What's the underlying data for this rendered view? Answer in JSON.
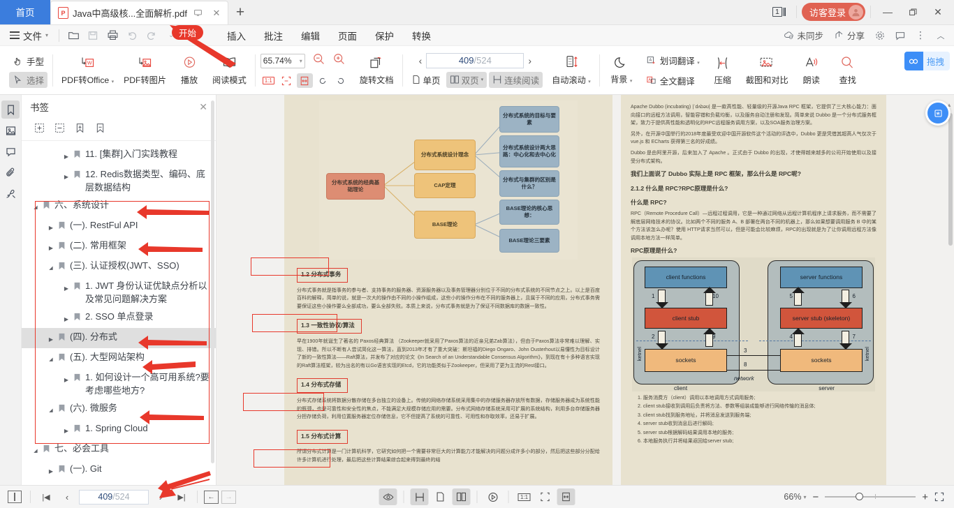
{
  "tabs": {
    "home_label": "首页",
    "doc_title": "Java中高级核...全面解析.pdf",
    "newtab_label": "+",
    "pdf_badge": "P"
  },
  "titlebar": {
    "page_count_badge": "1",
    "login_label": "访客登录",
    "minimize": "—",
    "restore": "❐",
    "close": "✕"
  },
  "menubar": {
    "file_label": "文件",
    "items": [
      "开始",
      "插入",
      "批注",
      "编辑",
      "页面",
      "保护",
      "转换"
    ],
    "active_item": "开始",
    "sync_label": "未同步",
    "share_label": "分享"
  },
  "ribbon": {
    "hand_label": "手型",
    "select_label": "选择",
    "pdf_to_office": "PDF转Office",
    "pdf_to_image": "PDF转图片",
    "play": "播放",
    "read_mode": "阅读模式",
    "zoom_value": "65.74%",
    "rotate_doc": "旋转文档",
    "page_current": "409",
    "page_sep": "/",
    "page_total": "524",
    "single_page": "单页",
    "double_page": "双页",
    "continuous_read": "连续阅读",
    "auto_scroll": "自动滚动",
    "background": "背景",
    "word_translate": "划词翻译",
    "full_translate": "全文翻译",
    "compress": "压缩",
    "screenshot_compare": "截图和对比",
    "read_aloud": "朗读",
    "find": "查找",
    "drag_label": "拖拽",
    "onetoone": "1:1"
  },
  "sidebar": {
    "rails": [
      "bookmark-icon",
      "thumbnail-icon",
      "comment-icon",
      "attachment-icon",
      "signature-icon"
    ],
    "active_rail": 0,
    "panel_title": "书签",
    "close": "✕",
    "tools": [
      "expand-all-icon",
      "collapse-all-icon",
      "add-bookmark-icon",
      "remove-bookmark-icon"
    ],
    "items": [
      {
        "label": "11. [集群]入门实践教程",
        "indent": 2,
        "arrow": "▸",
        "highlight": false
      },
      {
        "label": "12. Redis数据类型、编码、底层数据结构",
        "indent": 2,
        "arrow": "▸",
        "highlight": false
      },
      {
        "label": "六、系统设计",
        "indent": 0,
        "arrow": "◢",
        "highlight": false
      },
      {
        "label": "(一). RestFul API",
        "indent": 1,
        "arrow": "▸",
        "highlight": false
      },
      {
        "label": "(二). 常用框架",
        "indent": 1,
        "arrow": "▸",
        "highlight": false
      },
      {
        "label": "(三). 认证授权(JWT、SSO)",
        "indent": 1,
        "arrow": "◢",
        "highlight": false
      },
      {
        "label": "1. JWT 身份认证优缺点分析以及常见问题解决方案",
        "indent": 2,
        "arrow": "▸",
        "highlight": false
      },
      {
        "label": "2. SSO 单点登录",
        "indent": 2,
        "arrow": "▸",
        "highlight": false
      },
      {
        "label": "(四). 分布式",
        "indent": 1,
        "arrow": "▸",
        "highlight": true
      },
      {
        "label": "(五). 大型网站架构",
        "indent": 1,
        "arrow": "◢",
        "highlight": false
      },
      {
        "label": "1. 如何设计一个高可用系统?要考虑哪些地方?",
        "indent": 2,
        "arrow": "▸",
        "highlight": false
      },
      {
        "label": "(六). 微服务",
        "indent": 1,
        "arrow": "◢",
        "highlight": false
      },
      {
        "label": "1. Spring Cloud",
        "indent": 2,
        "arrow": "▸",
        "highlight": false
      },
      {
        "label": "七、必会工具",
        "indent": 0,
        "arrow": "◢",
        "highlight": false
      },
      {
        "label": "(一). Git",
        "indent": 1,
        "arrow": "▸",
        "highlight": false
      }
    ]
  },
  "document": {
    "left_page": {
      "mindmap": {
        "root": "分布式系统的经典基础理论",
        "mid": [
          "分布式系统设计理念",
          "CAP定理",
          "BASE理论"
        ],
        "leaves_top": [
          "分布式系统的目标与要素",
          "分布式系统设计两大思路：中心化和去中心化",
          "分布式与集群的区别是什么？"
        ],
        "leaves_bottom": [
          "BASE理论的核心思想：",
          "BASE理论三要素"
        ]
      },
      "sections": [
        {
          "heading": "1.2 分布式事务",
          "body": "分布式事务就是指事务的参与者、支持事务的服务器、资源服务器以及事务管理器分别位于不同的分布式系统的不同节点之上。以上是百度百科的解释，简单的说，就是一次大的操作由不同的小操作组成，这些小的操作分布在不同的服务器上，且属于不同的应用，分布式事务需要保证这些小操作要么全部成功，要么全部失败。本质上来说，分布式事务就是为了保证不同数据库的数据一致性。"
        },
        {
          "heading": "1.3 一致性协议/算法",
          "body": "早在1900年就诞生了著名的 Paxos经典算法 （Zookeeper就采用了Paxos算法的近亲兄弟Zab算法），但由于Paxos算法非常难以理解、实现、排错。所以不断有人尝试简化这一算法，直到2013年才有了重大突破：斯坦福的Diego Ongaro、John Ousterhout以易懂性为目标设计了新的一致性算法——Raft算法，并发布了对应的论文《In Search of an Understandable Consensus Algorithm》，到现在有十多种语言实现的Raft算法框架，较为出名的有以Go语言实现的Etcd，它的功能类似于Zookeeper，但采用了更为主流的Rest接口。"
        },
        {
          "heading": "1.4 分布式存储",
          "body": "分布式存储系统将数据分散存储在多台独立的设备上。传统的网络存储系统采用集中的存储服务器存放所有数据，存储服务器成为系统性能的瓶颈，也是可靠性和安全性的焦点，不能满足大规模存储应用的需要。分布式网络存储系统采用可扩展的系统结构，利用多台存储服务器分担存储负荷，利用位置服务器定位存储信息，它不但提高了系统的可靠性、可用性和存取效率，还易于扩展。"
        },
        {
          "heading": "1.5 分布式计算",
          "body": "所谓分布式计算是一门计算机科学，它研究如何把一个需要非常巨大的计算能力才能解决的问题分成许多小的部分，然后把这些部分分配给许多计算机进行处理，最后把这些计算结果综合起来得到最终的结"
        }
      ]
    },
    "right_page": {
      "paragraphs": [
        "Apache Dubbo (incubating) |ˈdʌbəʊ| 是一款高性能、轻量级的开源Java RPC 框架，它提供了三大核心能力：面向接口的远程方法调用，智能容错和负载均衡，以及服务自动注册和发现。简单来说 Dubbo 是一个分布式服务框架，致力于提供高性能和透明化的RPC远程服务调用方案，以及SOA服务治理方案。",
        "另外，在开源中国举行的2018年度最受欢迎中国开源软件这个活动的评选中，Dubbo 更是凭借其超高人气仅次于 vue.js 和 ECharts 获得第三名的好成绩。",
        "Dubbo 是由阿里开源，后来加入了 Apache 。正式由于 Dubbo 的出现，才使得越来越多的公司开始使用以及接受分布式架构。"
      ],
      "bold_line": "我们上面说了 Dubbo 实际上是 RPC 框架，那么什么是 RPC呢?",
      "heading2": "2.1.2 什么是 RPC?RPC原理是什么?",
      "heading3": "什么是 RPC?",
      "rpc_desc": "RPC（Remote Procedure Call）—远程过程调用，它是一种通过网络从远程计算机程序上请求服务，而不需要了解底层网络技术的协议。比如两个不同的服务 A、B 部署在两台不同的机器上，那么如果想要调用服务 B 中的某个方法该怎么办呢？使用 HTTP请求当然可以，但是可能会比较麻烦，RPC的出现就是为了让你调用远程方法像调用本地方法一样简单。",
      "heading4": "RPC原理是什么?",
      "rpc_diagram": {
        "client_functions": "client functions",
        "server_functions": "server functions",
        "client_stub": "client stub",
        "server_stub": "server stub (skeleton)",
        "sockets": "sockets",
        "kernel": "ketnel",
        "network": "network",
        "client_label": "client",
        "server_label": "server",
        "numbers": [
          "1",
          "10",
          "2",
          "9",
          "3",
          "8",
          "5",
          "6",
          "4",
          "7"
        ]
      },
      "steps": [
        "1. 服务消费方（client）调用以本地调用方式调用服务;",
        "2. client stub接收到调用后负责将方法、参数等组装成能够进行网络传输的消息体;",
        "3. client stub找到服务地址，并将消息发送到服务端;",
        "4. server stub收到消息后进行解码;",
        "5. server stub根据解码结果调用本地的服务;",
        "6. 本地服务执行并将结果返回给server stub;"
      ]
    }
  },
  "statusbar": {
    "page_current": "409",
    "page_sep": "/",
    "page_total": "524",
    "zoom": "66%",
    "first_page": "|◀",
    "prev_page": "‹",
    "next_page": "›",
    "last_page": "▶|",
    "back": "←",
    "forward": "→",
    "zoom_out": "−",
    "zoom_in": "+",
    "onetoone": "1:1"
  },
  "colors": {
    "accent_blue": "#3b7ddd",
    "annotation_red": "#e8382b",
    "login_red": "#e06252",
    "page_bg": "#e8e2cf"
  }
}
